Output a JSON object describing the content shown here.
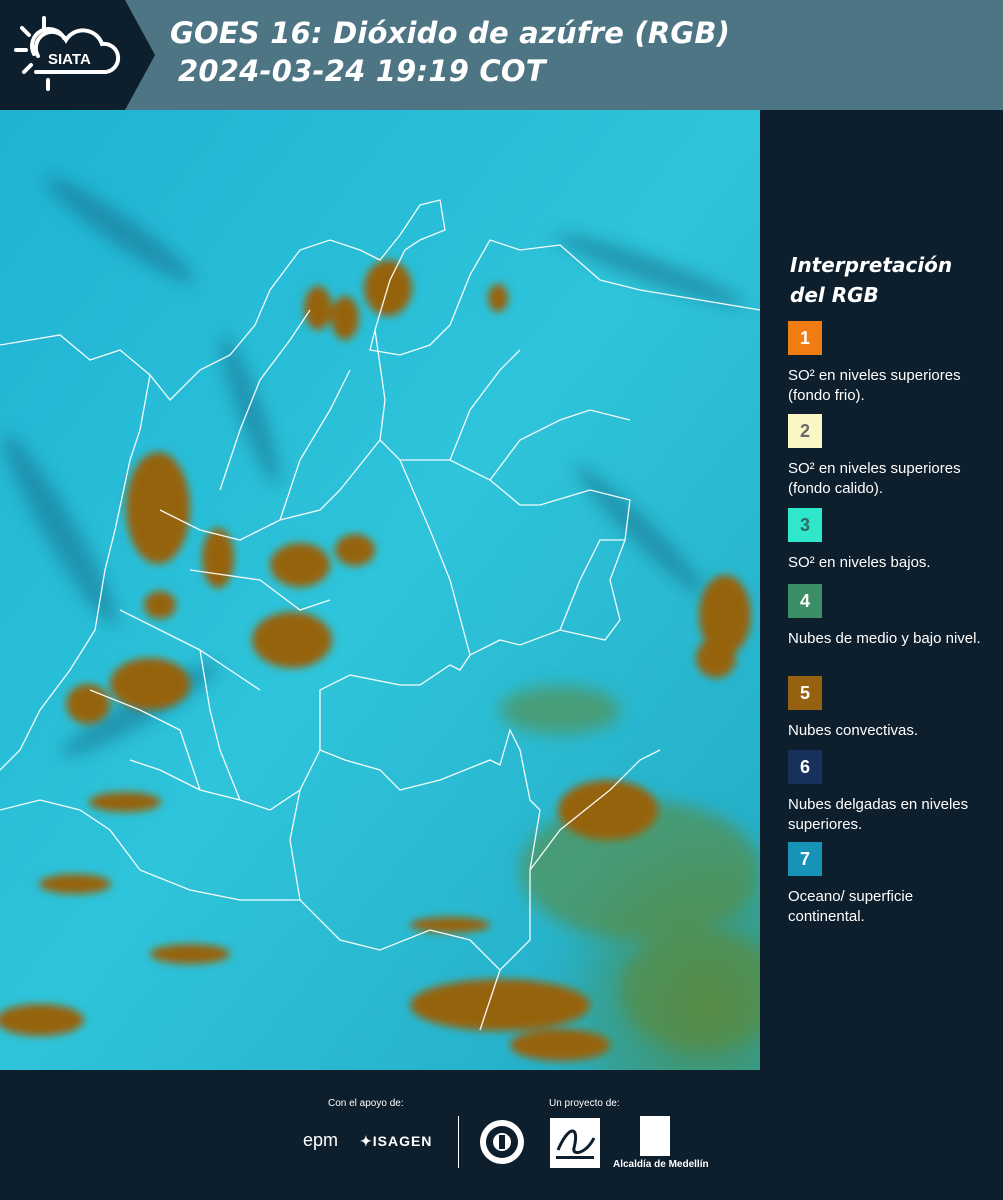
{
  "header": {
    "logo_text": "SIATA",
    "title_line1": "GOES 16: Dióxido de azúfre (RGB)",
    "title_line2": "2024-03-24 19:19 COT"
  },
  "legend": {
    "title_line1": "Interpretación",
    "title_line2": "del RGB",
    "items": [
      {
        "number": "1",
        "color": "#f07c12",
        "number_color": "#ffffff",
        "label": "SO² en niveles superiores (fondo frio)."
      },
      {
        "number": "2",
        "color": "#fbf6c6",
        "number_color": "#6a6a6a",
        "label": "SO² en niveles superiores (fondo calido)."
      },
      {
        "number": "3",
        "color": "#2fe8cb",
        "number_color": "#2a6b62",
        "label": "SO² en niveles bajos."
      },
      {
        "number": "4",
        "color": "#3c8e64",
        "number_color": "#ffffff",
        "label": "Nubes de medio y bajo nivel."
      },
      {
        "number": "5",
        "color": "#96620f",
        "number_color": "#ffffff",
        "label": "Nubes convectivas."
      },
      {
        "number": "6",
        "color": "#17315c",
        "number_color": "#ffffff",
        "label": "Nubes delgadas en niveles superiores."
      },
      {
        "number": "7",
        "color": "#1694b8",
        "number_color": "#ffffff",
        "label": "Oceano/ superficie continental."
      }
    ]
  },
  "footer": {
    "support_label": "Con el apoyo de:",
    "project_label": "Un proyecto de:",
    "sponsor1": "epm",
    "sponsor2": "ISAGEN",
    "partner1": "Área Metropolitana Valle de Aburrá",
    "partner2": "Alcaldía de Medellín"
  },
  "colors": {
    "background": "#0d1e2c",
    "header": "#4e7584",
    "map_base": "#22b7d4",
    "convective_clouds": "#96620f"
  }
}
